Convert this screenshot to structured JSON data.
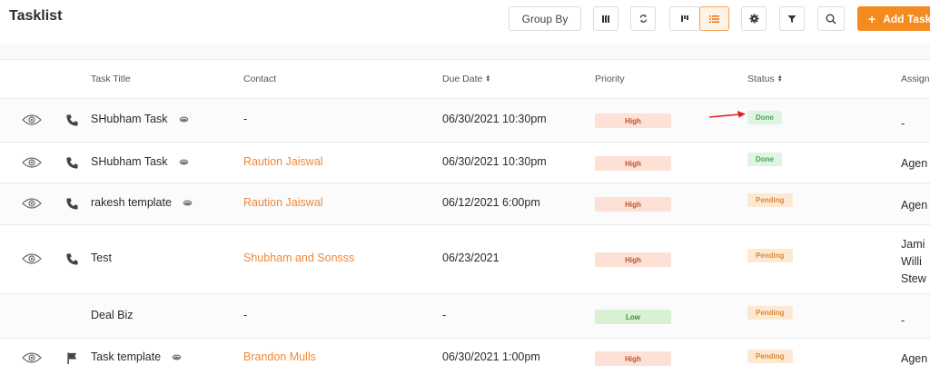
{
  "page": {
    "title": "Tasklist"
  },
  "toolbar": {
    "group_by_label": "Group By",
    "add_label": "Add Task"
  },
  "columns": {
    "title": "Task Title",
    "contact": "Contact",
    "due": "Due Date",
    "priority": "Priority",
    "status": "Status",
    "assign": "Assign"
  },
  "rows": [
    {
      "title": "SHubham Task",
      "contact": "-",
      "due": "06/30/2021 10:30pm",
      "priority": "High",
      "status": "Done",
      "assign": [
        "-"
      ]
    },
    {
      "title": "SHubham Task",
      "contact": "Raution Jaiswal",
      "due": "06/30/2021 10:30pm",
      "priority": "High",
      "status": "Done",
      "assign": [
        "Agen"
      ]
    },
    {
      "title": "rakesh template",
      "contact": "Raution Jaiswal",
      "due": "06/12/2021 6:00pm",
      "priority": "High",
      "status": "Pending",
      "assign": [
        "Agen"
      ]
    },
    {
      "title": "Test",
      "contact": "Shubham and Sonsss",
      "due": "06/23/2021",
      "priority": "High",
      "status": "Pending",
      "assign": [
        "Jami",
        "Willi",
        "Stew"
      ]
    },
    {
      "title": "Deal Biz",
      "contact": "-",
      "due": "-",
      "priority": "Low",
      "status": "Pending",
      "assign": [
        "-"
      ]
    },
    {
      "title": "Task template",
      "contact": "Brandon Mulls",
      "due": "06/30/2021 1:00pm",
      "priority": "High",
      "status": "Pending",
      "assign": [
        "Agen"
      ]
    }
  ],
  "colors": {
    "accent": "#f58a1f",
    "link": "#f0883a",
    "annotation_arrow": "#e02020"
  }
}
